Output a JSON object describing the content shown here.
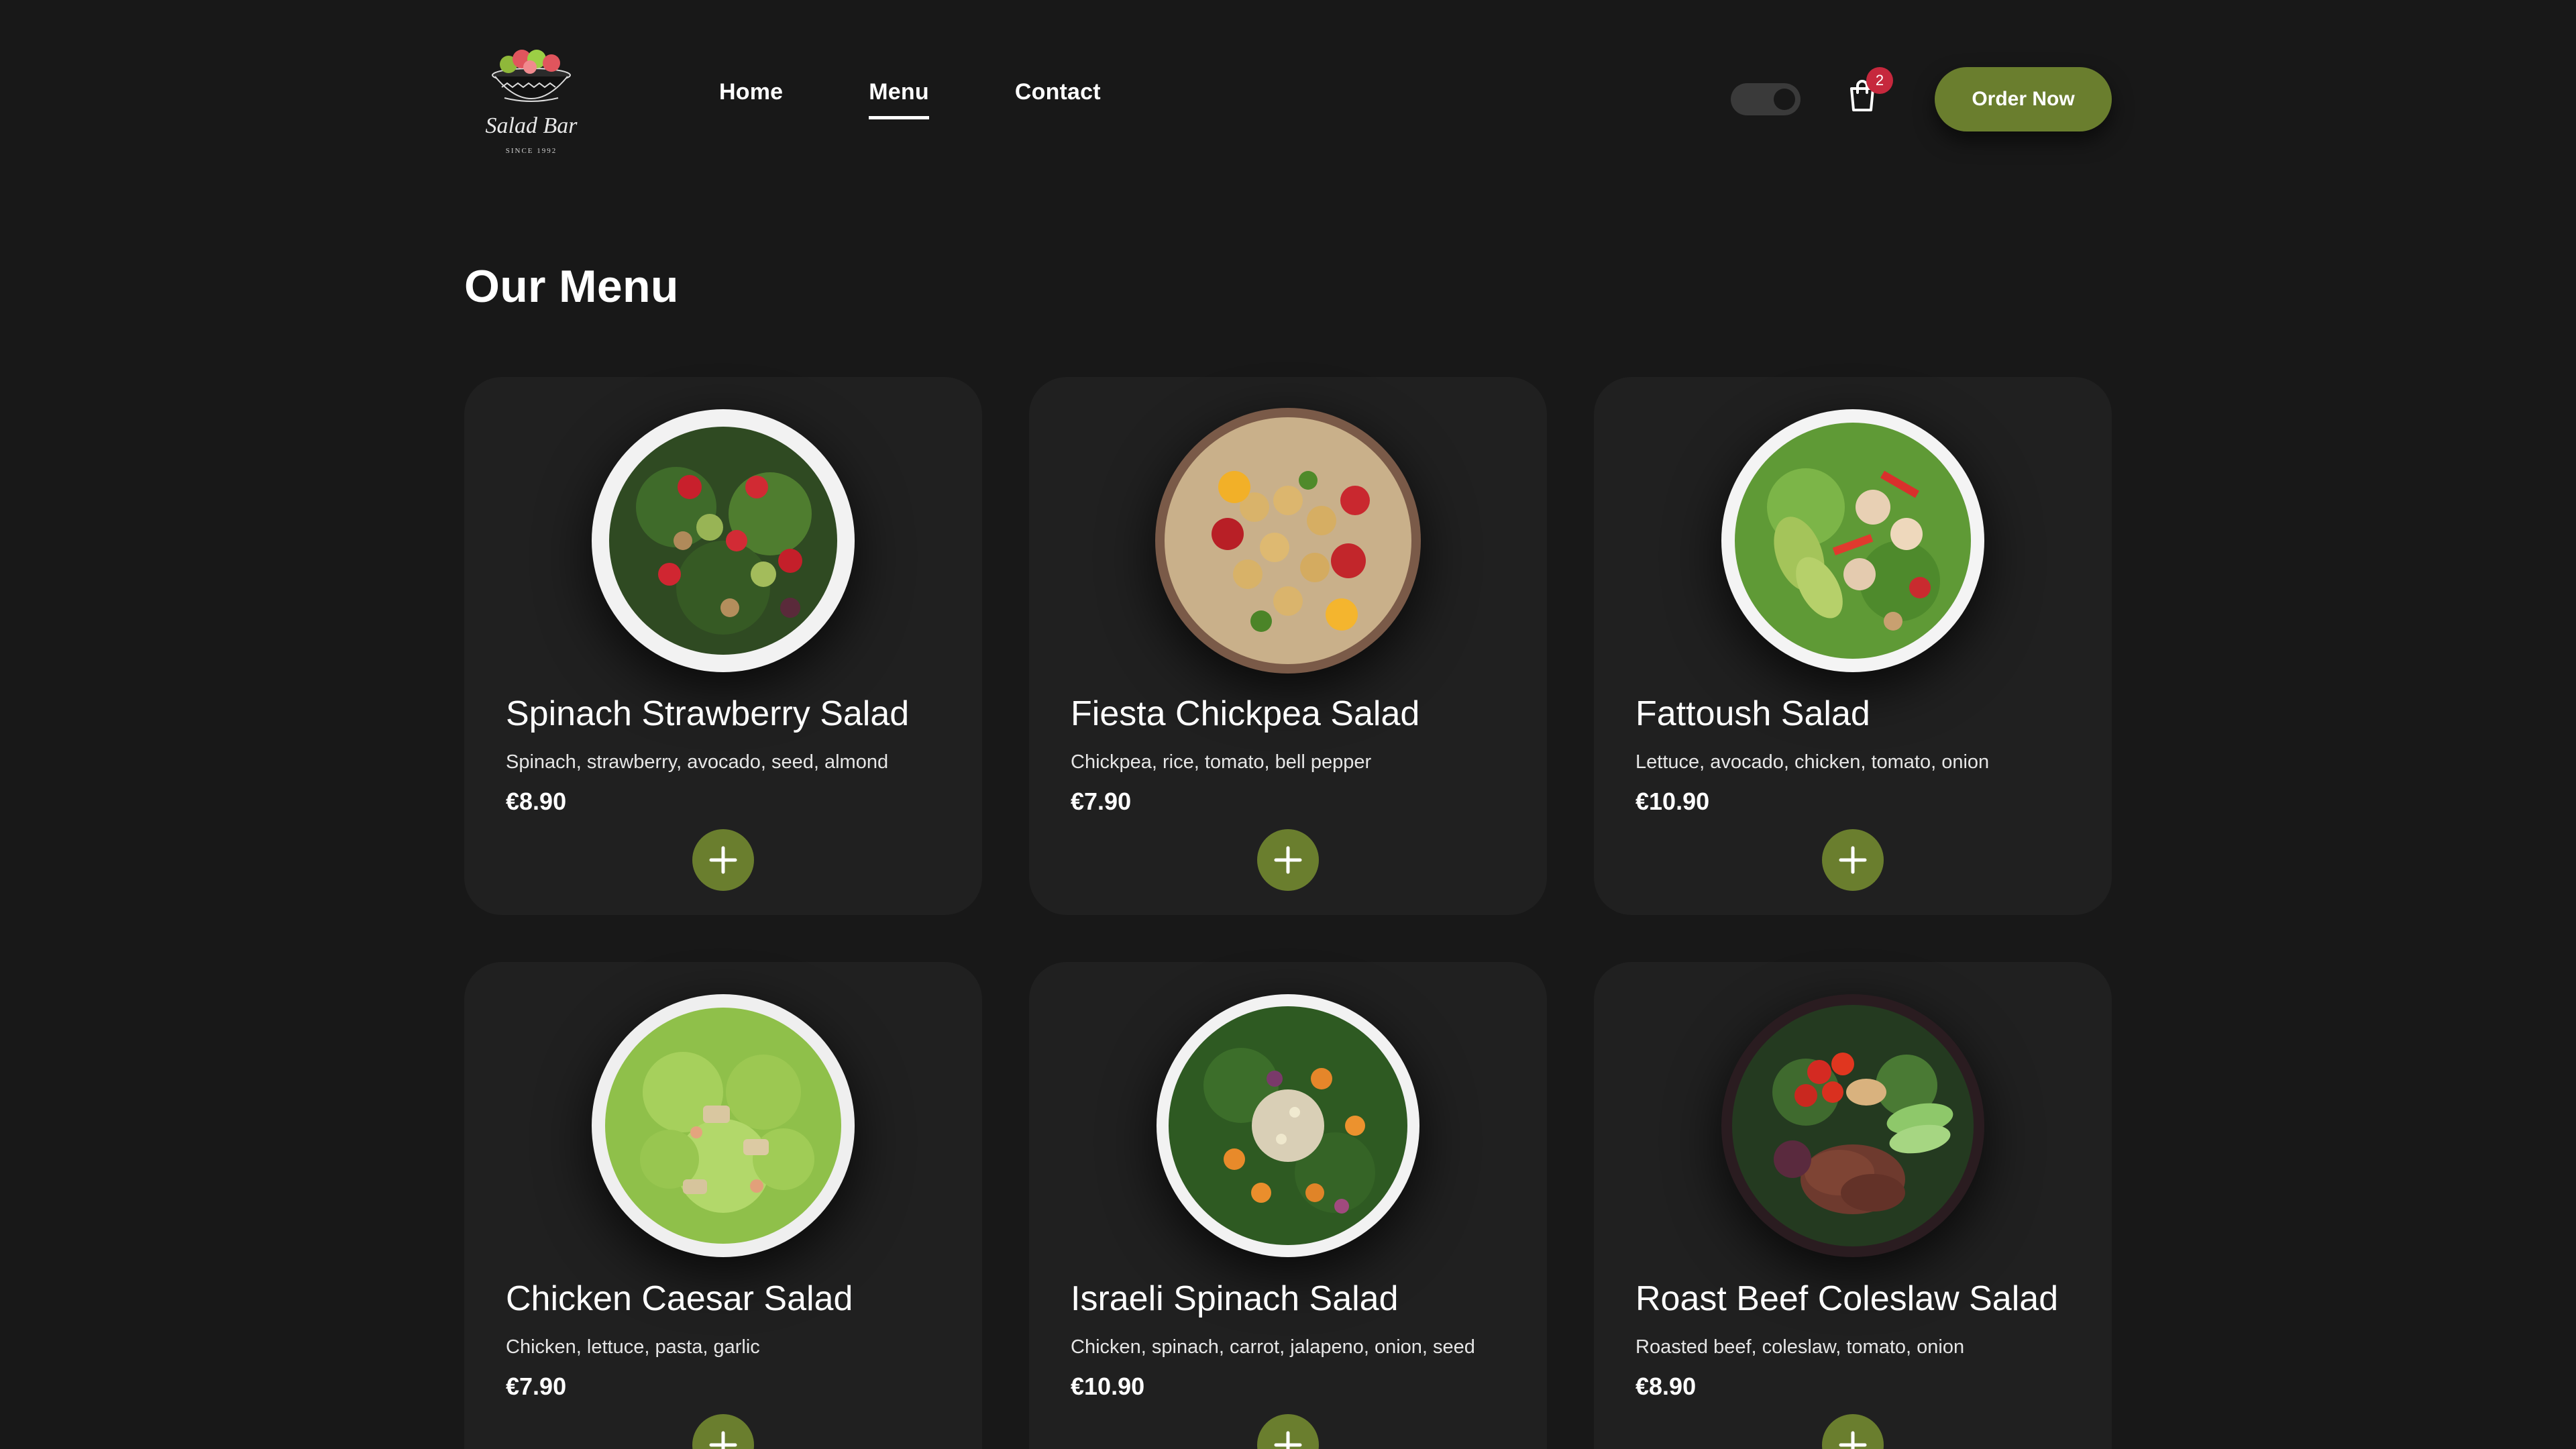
{
  "brand": {
    "logo_alt": "Salad Bar",
    "logo_script": "Salad Bar",
    "logo_since": "SINCE 1992"
  },
  "nav": {
    "items": [
      {
        "label": "Home",
        "active": false
      },
      {
        "label": "Menu",
        "active": true
      },
      {
        "label": "Contact",
        "active": false
      }
    ]
  },
  "header": {
    "cart_count": "2",
    "order_button_label": "Order Now",
    "theme_toggle_state": "dark"
  },
  "main": {
    "title": "Our Menu",
    "menu_items": [
      {
        "name": "Spinach Strawberry Salad",
        "ingredients": "Spinach, strawberry, avocado, seed, almond",
        "price": "€8.90",
        "image": "spinach-strawberry-salad-image"
      },
      {
        "name": "Fiesta Chickpea Salad",
        "ingredients": "Chickpea, rice, tomato, bell pepper",
        "price": "€7.90",
        "image": "fiesta-chickpea-salad-image"
      },
      {
        "name": "Fattoush Salad",
        "ingredients": "Lettuce, avocado, chicken, tomato, onion",
        "price": "€10.90",
        "image": "fattoush-salad-image"
      },
      {
        "name": "Chicken Caesar Salad",
        "ingredients": "Chicken, lettuce, pasta, garlic",
        "price": "€7.90",
        "image": "chicken-caesar-salad-image"
      },
      {
        "name": "Israeli Spinach Salad",
        "ingredients": "Chicken, spinach, carrot, jalapeno, onion, seed",
        "price": "€10.90",
        "image": "israeli-spinach-salad-image"
      },
      {
        "name": "Roast Beef Coleslaw Salad",
        "ingredients": "Roasted beef, coleslaw, tomato, onion",
        "price": "€8.90",
        "image": "roast-beef-coleslaw-salad-image"
      }
    ]
  },
  "colors": {
    "background": "#181818",
    "card": "#202020",
    "accent": "#6a7e2e",
    "badge": "#c6283d",
    "text": "#ffffff"
  },
  "icons": {
    "cart": "shopping-bag-icon",
    "add": "plus-icon",
    "toggle": "theme-toggle"
  }
}
